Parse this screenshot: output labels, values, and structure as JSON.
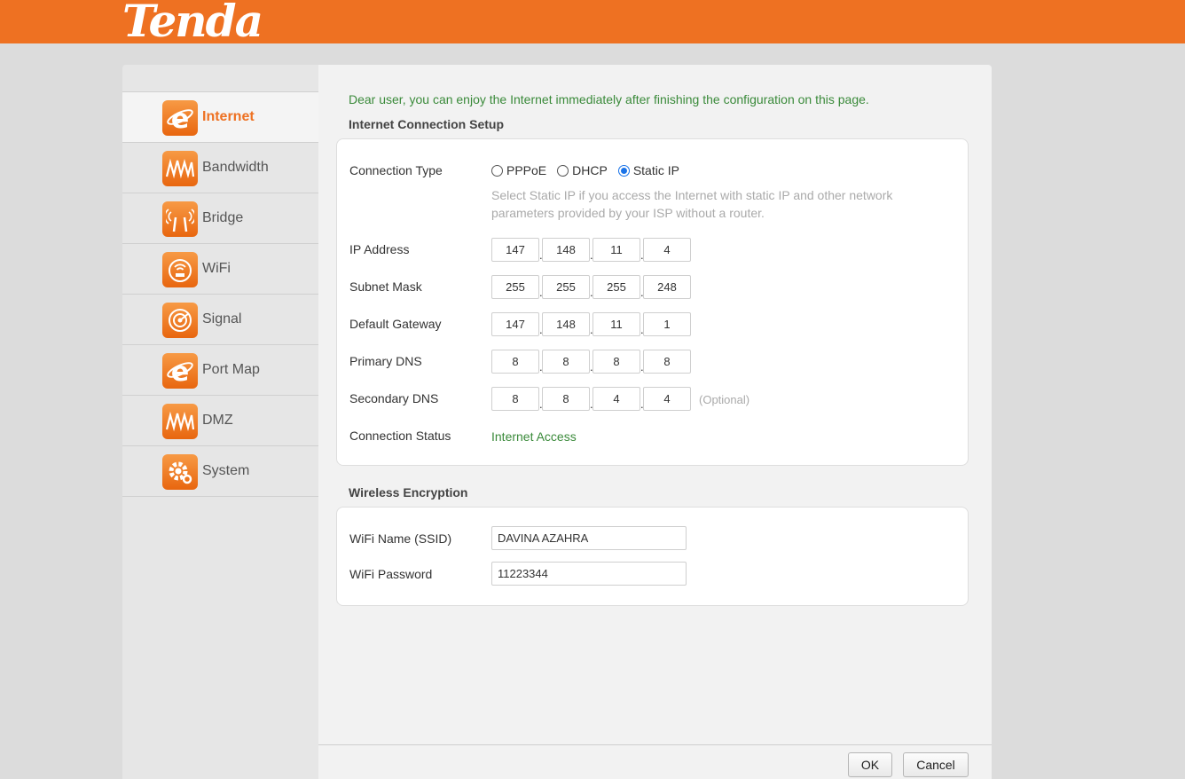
{
  "brand": {
    "logo": "Tenda",
    "color": "#ee7122"
  },
  "sidebar": {
    "items": [
      {
        "label": "Internet",
        "icon": "internet-e-icon",
        "active": true
      },
      {
        "label": "Bandwidth",
        "icon": "bandwidth-icon",
        "active": false
      },
      {
        "label": "Bridge",
        "icon": "bridge-icon",
        "active": false
      },
      {
        "label": "WiFi",
        "icon": "wifi-icon",
        "active": false
      },
      {
        "label": "Signal",
        "icon": "signal-icon",
        "active": false
      },
      {
        "label": "Port Map",
        "icon": "port-map-icon",
        "active": false
      },
      {
        "label": "DMZ",
        "icon": "dmz-icon",
        "active": false
      },
      {
        "label": "System",
        "icon": "system-gear-icon",
        "active": false
      }
    ]
  },
  "main": {
    "intro": "Dear user, you can enjoy the Internet immediately after finishing the configuration on this page.",
    "internet": {
      "title": "Internet Connection Setup",
      "connection_type_label": "Connection Type",
      "options": [
        {
          "label": "PPPoE",
          "selected": false
        },
        {
          "label": "DHCP",
          "selected": false
        },
        {
          "label": "Static IP",
          "selected": true
        }
      ],
      "hint": "Select Static IP if you access the Internet with static IP and other network parameters provided by your ISP without a router.",
      "ip_label": "IP Address",
      "ip": [
        "147",
        "148",
        "11",
        "4"
      ],
      "mask_label": "Subnet Mask",
      "mask": [
        "255",
        "255",
        "255",
        "248"
      ],
      "gateway_label": "Default Gateway",
      "gateway": [
        "147",
        "148",
        "11",
        "1"
      ],
      "dns1_label": "Primary DNS",
      "dns1": [
        "8",
        "8",
        "8",
        "8"
      ],
      "dns2_label": "Secondary DNS",
      "dns2": [
        "8",
        "8",
        "4",
        "4"
      ],
      "optional": "(Optional)",
      "status_label": "Connection Status",
      "status": "Internet Access"
    },
    "wireless": {
      "title": "Wireless Encryption",
      "ssid_label": "WiFi Name (SSID)",
      "ssid": "DAVINA AZAHRA",
      "password_label": "WiFi Password",
      "password": "11223344"
    },
    "buttons": {
      "ok": "OK",
      "cancel": "Cancel"
    }
  }
}
